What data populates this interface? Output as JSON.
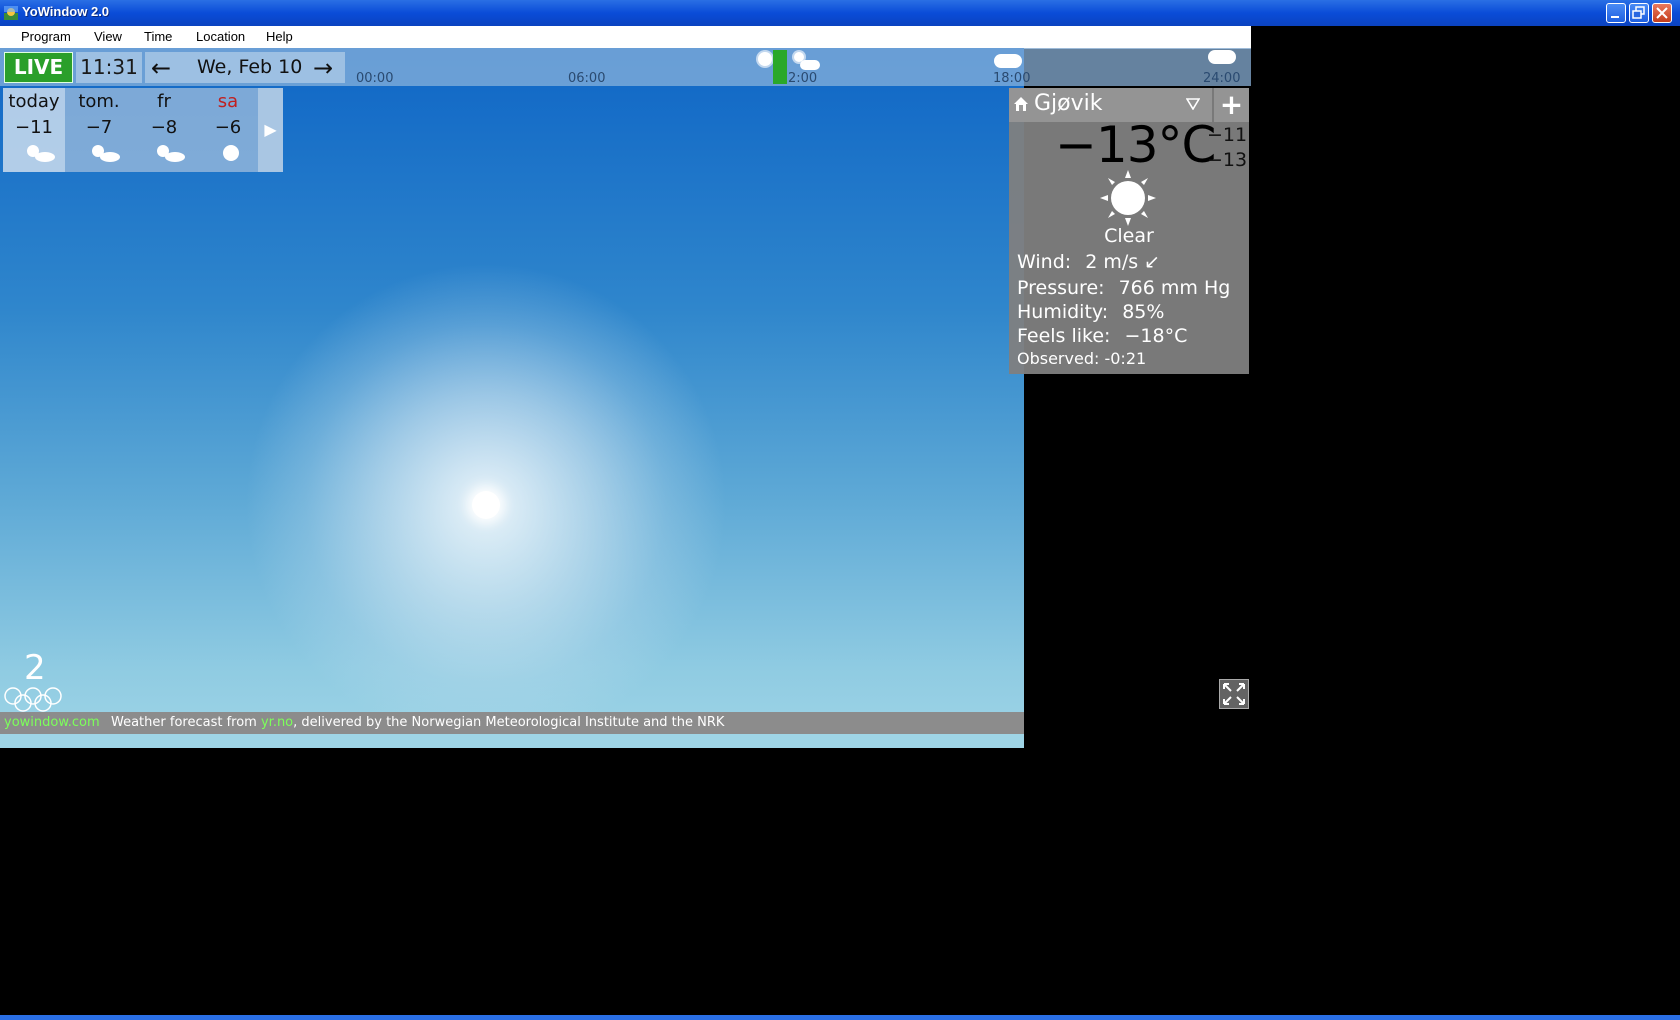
{
  "window": {
    "title": "YoWindow 2.0"
  },
  "menu": [
    "Program",
    "View",
    "Time",
    "Location",
    "Help"
  ],
  "topbar": {
    "live_label": "LIVE",
    "time": "11:31",
    "prev_arrow": "←",
    "next_arrow": "→",
    "date": "We, Feb 10"
  },
  "timeline": {
    "ticks": [
      "00:00",
      "06:00",
      "2:00",
      "18:00",
      "24:00"
    ]
  },
  "forecast": {
    "days": [
      {
        "name": "today",
        "temp": "−11",
        "icon": "sun-cloud-icon"
      },
      {
        "name": "tom.",
        "temp": "−7",
        "icon": "sun-cloud-icon"
      },
      {
        "name": "fr",
        "temp": "−8",
        "icon": "sun-cloud-icon"
      },
      {
        "name": "sa",
        "temp": "−6",
        "icon": "sun-icon"
      }
    ],
    "next": "▶"
  },
  "location": {
    "name": "Gjøvik",
    "add": "+",
    "current_temp": "−13°C",
    "high": "−11",
    "low": "−13",
    "condition": "Clear",
    "wind_label": "Wind:",
    "wind_value": "2 m/s ↙",
    "pressure_label": "Pressure:",
    "pressure_value": "766 mm Hg",
    "humidity_label": "Humidity:",
    "humidity_value": "85%",
    "feels_label": "Feels like:",
    "feels_value": "−18°C",
    "observed_label": "Observed:",
    "observed_value": "-0:21"
  },
  "footer": {
    "site": "yowindow.com",
    "text_prefix": "Weather forecast from ",
    "yr": "yr.no",
    "text_suffix": ", delivered by the Norwegian Meteorological Institute and the NRK"
  },
  "olympic_number": "2",
  "colors": {
    "live": "#2a9f2a",
    "title_bar": "#0a4cd8",
    "saturday": "#c02020"
  }
}
